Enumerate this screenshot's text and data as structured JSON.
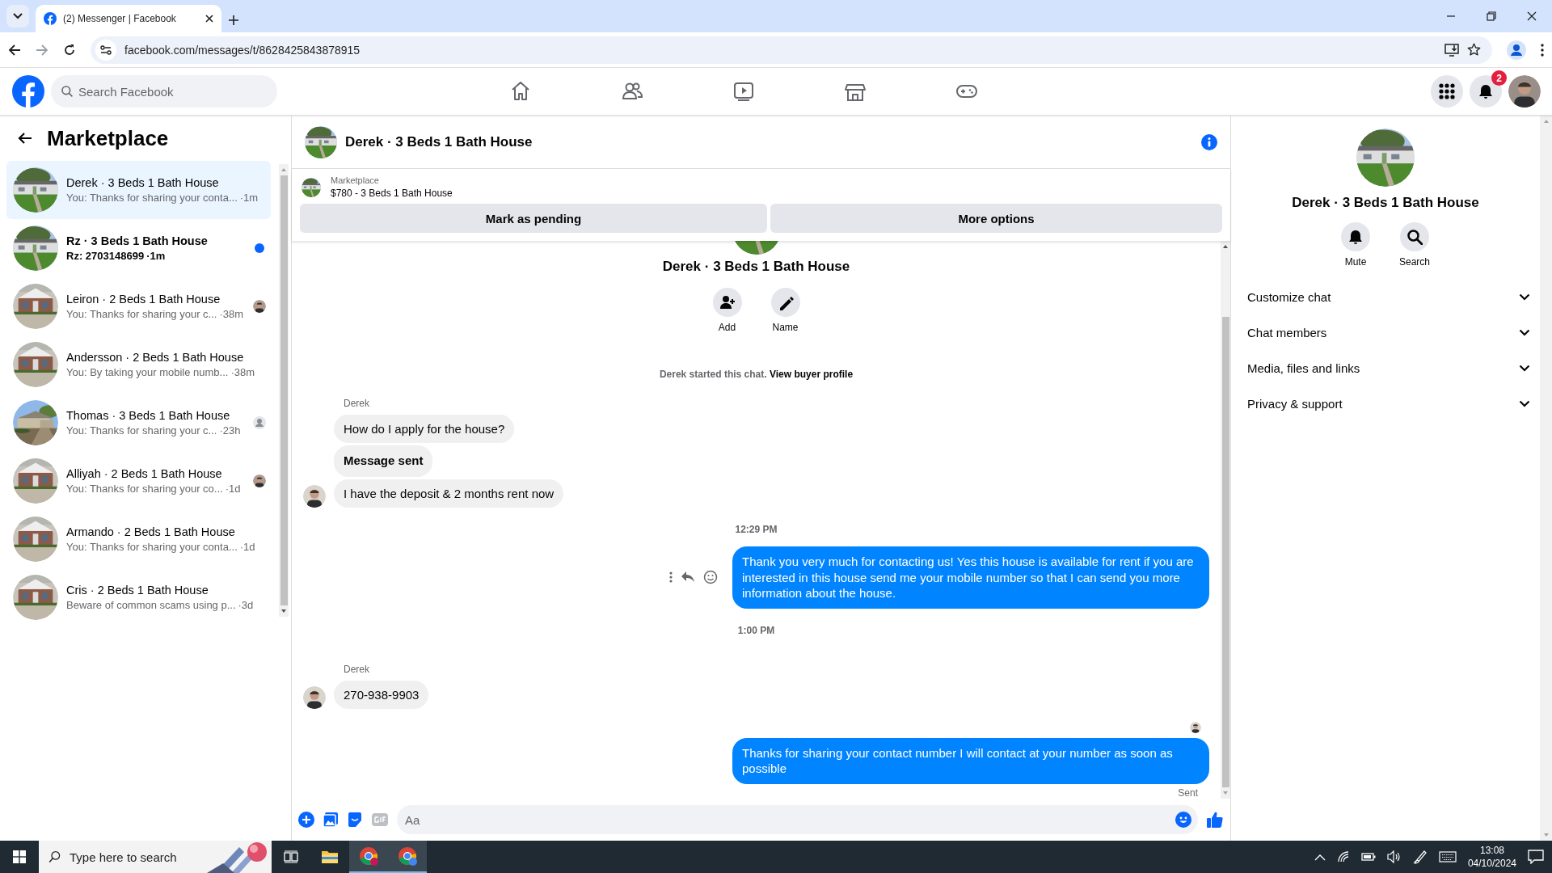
{
  "browser": {
    "tabs": [
      {
        "title": "(2) Messenger | Facebook",
        "selected": true
      }
    ],
    "url": "facebook.com/messages/t/8628425843878915"
  },
  "topbar": {
    "search_placeholder": "Search Facebook",
    "nav": [
      {
        "kind": "home"
      },
      {
        "kind": "friends"
      },
      {
        "kind": "video"
      },
      {
        "kind": "marketplace"
      },
      {
        "kind": "gaming"
      }
    ],
    "notification_count": "2"
  },
  "sidebar": {
    "title": "Marketplace",
    "chats": [
      {
        "name": "Derek · 3 Beds 1 Bath House",
        "preview": "You: Thanks for sharing your conta...",
        "time": "·1m",
        "selected": true,
        "unread": false,
        "seen": false,
        "seen_placeholder": false
      },
      {
        "name": "Rz · 3 Beds 1 Bath House",
        "preview": "Rz: 2703148699",
        "time": "·1m",
        "selected": false,
        "unread": true,
        "seen": false,
        "seen_placeholder": false
      },
      {
        "name": "Leiron · 2 Beds 1 Bath House",
        "preview": "You: Thanks for sharing your c...",
        "time": "·38m",
        "selected": false,
        "unread": false,
        "seen": true,
        "seen_placeholder": false
      },
      {
        "name": "Andersson · 2 Beds 1 Bath House",
        "preview": "You: By taking your mobile numb...",
        "time": "·38m",
        "selected": false,
        "unread": false,
        "seen": false,
        "seen_placeholder": false
      },
      {
        "name": "Thomas · 3 Beds 1 Bath House",
        "preview": "You: Thanks for sharing your c...",
        "time": "·23h",
        "selected": false,
        "unread": false,
        "seen": false,
        "seen_placeholder": true
      },
      {
        "name": "Alliyah · 2 Beds 1 Bath House",
        "preview": "You: Thanks for sharing your co...",
        "time": "·1d",
        "selected": false,
        "unread": false,
        "seen": true,
        "seen_placeholder": false
      },
      {
        "name": "Armando · 2 Beds 1 Bath House",
        "preview": "You: Thanks for sharing your conta...",
        "time": "·1d",
        "selected": false,
        "unread": false,
        "seen": false,
        "seen_placeholder": false
      },
      {
        "name": "Cris · 2 Beds 1 Bath House",
        "preview": "Beware of common scams using p...",
        "time": "·3d",
        "selected": false,
        "unread": false,
        "seen": false,
        "seen_placeholder": false
      }
    ]
  },
  "chat": {
    "title": "Derek · 3 Beds 1 Bath House",
    "listing": {
      "label": "Marketplace",
      "title": "$780 - 3 Beds 1 Bath House",
      "buttons": [
        "Mark as pending",
        "More options"
      ]
    },
    "intro": {
      "name": "Derek · 3 Beds 1 Bath House",
      "actions": [
        {
          "label": "Add",
          "kind": "add-person"
        },
        {
          "label": "Name",
          "kind": "pencil"
        }
      ],
      "started": "Derek started this chat.",
      "link": "View buyer profile"
    },
    "messages": [
      {
        "kind": "sender",
        "text": "Derek"
      },
      {
        "kind": "incoming",
        "text": "How do I apply for the house?",
        "avatar": false,
        "bold": false
      },
      {
        "kind": "incoming",
        "text": "Message sent",
        "avatar": false,
        "bold": true
      },
      {
        "kind": "incoming",
        "text": "I have the deposit & 2 months rent now",
        "avatar": true,
        "bold": false
      },
      {
        "kind": "time",
        "text": "12:29 PM"
      },
      {
        "kind": "outgoing",
        "text": "Thank you very much for contacting us! Yes this house is available for rent if you are interested in this house send me your mobile number so that I can send you more information about the house.",
        "actions": true
      },
      {
        "kind": "time",
        "text": "1:00 PM"
      },
      {
        "kind": "sender",
        "text": "Derek"
      },
      {
        "kind": "incoming",
        "text": "270-938-9903",
        "avatar": true,
        "bold": false
      },
      {
        "kind": "seen"
      },
      {
        "kind": "outgoing",
        "text": "Thanks for sharing your contact number I will contact at your number as soon as possible",
        "actions": false
      },
      {
        "kind": "status",
        "text": "Sent"
      }
    ],
    "composer": {
      "placeholder": "Aa"
    }
  },
  "details": {
    "name": "Derek · 3 Beds 1 Bath House",
    "actions": [
      {
        "label": "Mute",
        "kind": "bell"
      },
      {
        "label": "Search",
        "kind": "search"
      }
    ],
    "sections": [
      {
        "label": "Customize chat",
        "expanded": false
      },
      {
        "label": "Chat members",
        "expanded": false
      },
      {
        "label": "Media, files and links",
        "expanded": false
      },
      {
        "label": "Privacy & support",
        "expanded": false
      }
    ]
  },
  "taskbar": {
    "search_placeholder": "Type here to search",
    "time": "13:08",
    "date": "04/10/2024"
  }
}
